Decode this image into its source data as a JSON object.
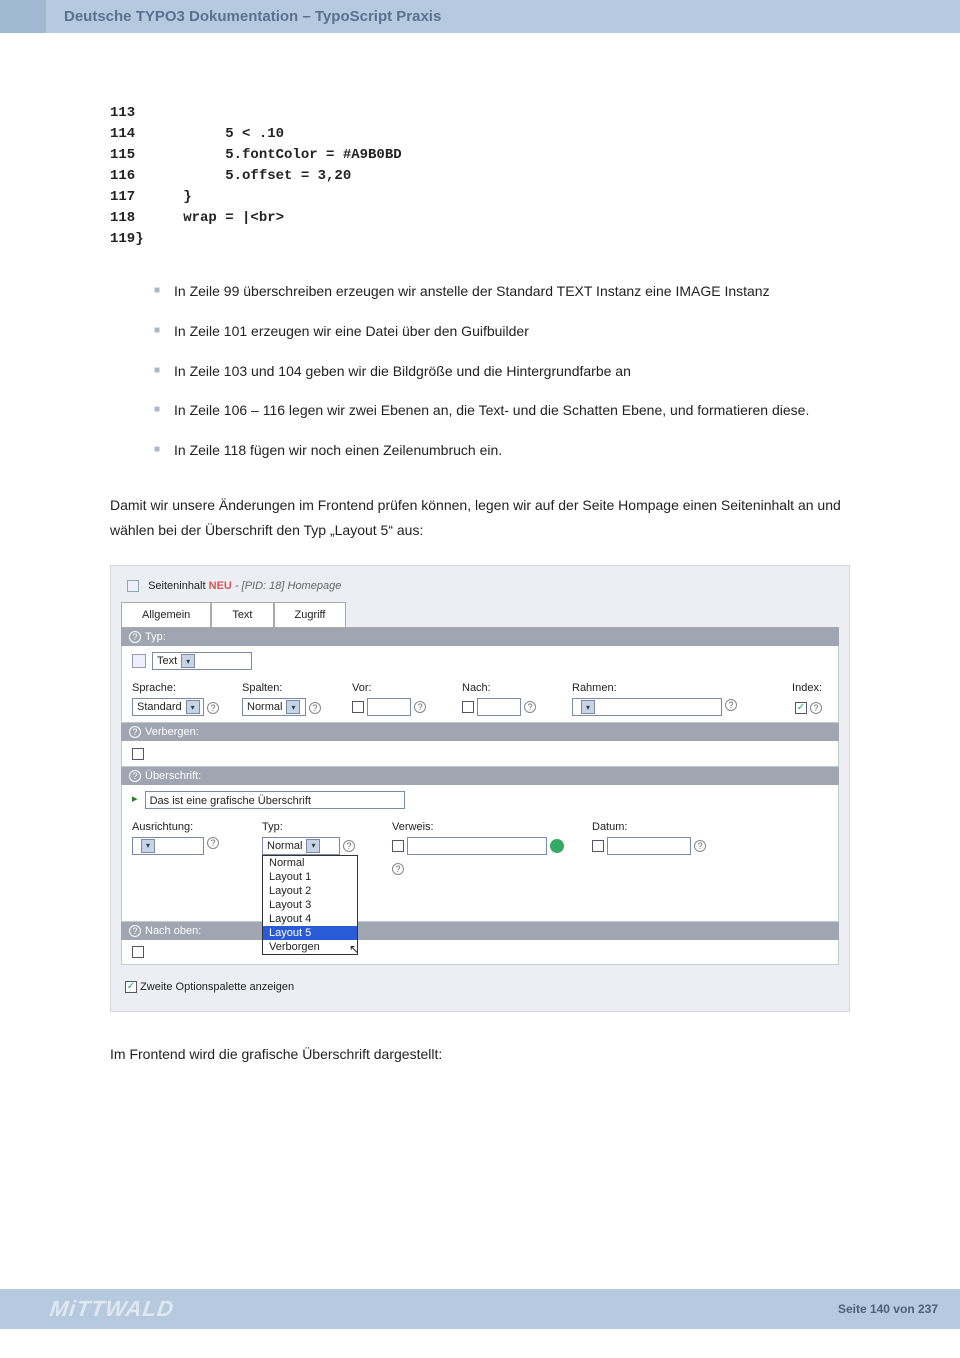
{
  "header": {
    "title": "Deutsche TYPO3 Dokumentation – TypoScript Praxis"
  },
  "code": [
    {
      "n": "113",
      "t": ""
    },
    {
      "n": "114",
      "t": "        5 < .10"
    },
    {
      "n": "115",
      "t": "        5.fontColor = #A9B0BD"
    },
    {
      "n": "116",
      "t": "        5.offset = 3,20"
    },
    {
      "n": "117",
      "t": "   }"
    },
    {
      "n": "118",
      "t": "   wrap = |<br>"
    },
    {
      "n": "119}",
      "t": ""
    }
  ],
  "bullets": [
    "In Zeile 99 überschreiben erzeugen wir anstelle der Standard TEXT Instanz eine IMAGE Instanz",
    "In Zeile 101 erzeugen wir eine Datei über den Guifbuilder",
    "In Zeile 103 und 104 geben wir die Bildgröße und die Hintergrundfarbe an",
    "In Zeile 106 – 116 legen wir zwei Ebenen an, die Text- und die Schatten Ebene, und formatieren diese.",
    "In Zeile 118 fügen wir noch einen Zeilenumbruch ein."
  ],
  "para1": "Damit wir unsere Änderungen im Frontend prüfen können, legen wir auf der Seite Hompage einen Seiteninhalt an und wählen bei der Überschrift den Typ „Layout 5“ aus:",
  "screenshot": {
    "title_prefix": "Seiteninhalt",
    "title_neu": "NEU",
    "title_pid": " - [PID: 18] Homepage",
    "tabs": [
      "Allgemein",
      "Text",
      "Zugriff"
    ],
    "sec_typ": "Typ:",
    "typ_value": "Text",
    "lbl_sprache": "Sprache:",
    "lbl_spalten": "Spalten:",
    "lbl_vor": "Vor:",
    "lbl_nach": "Nach:",
    "lbl_rahmen": "Rahmen:",
    "lbl_index": "Index:",
    "val_sprache": "Standard",
    "val_spalten": "Normal",
    "sec_verbergen": "Verbergen:",
    "sec_uberschrift": "Überschrift:",
    "uberschrift_value": "Das ist eine grafische Überschrift",
    "lbl_ausrichtung": "Ausrichtung:",
    "lbl_typ2": "Typ:",
    "lbl_verweis": "Verweis:",
    "lbl_datum": "Datum:",
    "typ2_value": "Normal",
    "dropdown_options": [
      "Normal",
      "Layout 1",
      "Layout 2",
      "Layout 3",
      "Layout 4",
      "Layout 5",
      "Verborgen"
    ],
    "dropdown_selected_index": 5,
    "sec_nachoben": "Nach oben:",
    "option_label": "Zweite Optionspalette anzeigen"
  },
  "para2": "Im Frontend wird die grafische Überschrift dargestellt:",
  "footer": {
    "logo": "MiTTWALD",
    "page": "Seite 140 von 237"
  }
}
